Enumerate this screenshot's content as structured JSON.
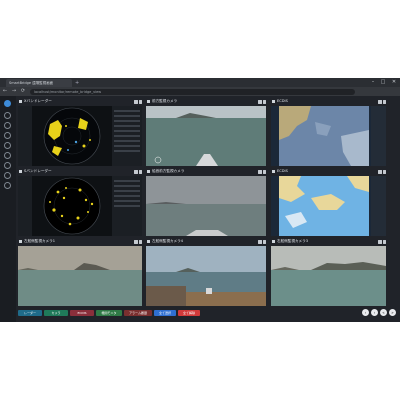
{
  "browser": {
    "tab_title": "SmartBridge 遠隔監視画面",
    "new_tab": "+",
    "url": "localhost/monitor/remote_bridge_view",
    "controls": {
      "minimize": "–",
      "maximize": "□",
      "close": "✕"
    },
    "nav": {
      "back": "←",
      "forward": "→",
      "reload": "⟳"
    }
  },
  "panels": [
    {
      "title": "Xバンドレーダー"
    },
    {
      "title": "前方監視カメラ"
    },
    {
      "title": "ECDIS"
    },
    {
      "title": "Sバンドレーダー"
    },
    {
      "title": "船首前方監視カメラ"
    },
    {
      "title": "ECDIS"
    },
    {
      "title": "左舷側監視カメラ1"
    },
    {
      "title": "左舷側監視カメラ4"
    },
    {
      "title": "右舷側監視カメラ3"
    }
  ],
  "bottom_buttons": [
    {
      "label": "レーダー",
      "color": "#1f6b8a"
    },
    {
      "label": "カメラ",
      "color": "#1f7a5a"
    },
    {
      "label": "ECDIS",
      "color": "#8a2f3b"
    },
    {
      "label": "機関モニタ",
      "color": "#2f7a46"
    },
    {
      "label": "アラーム履歴",
      "color": "#7a2f2f"
    },
    {
      "label": "全て選択",
      "color": "#2f6fd1"
    },
    {
      "label": "全て解除",
      "color": "#d13a3a"
    }
  ],
  "nav_buttons": [
    "‹",
    "›",
    "«",
    "»"
  ],
  "colors": {
    "window_bg": "#202329",
    "radar_echo": "#e8d21a",
    "sea": "#6f8c86"
  }
}
